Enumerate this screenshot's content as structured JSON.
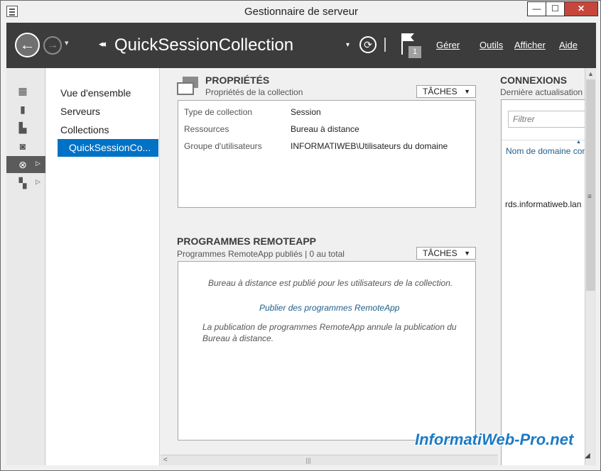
{
  "window": {
    "title": "Gestionnaire de serveur",
    "controls": {
      "minimize": "—",
      "maximize": "☐",
      "close": "✕"
    }
  },
  "navbar": {
    "back_icon": "←",
    "forward_icon": "→",
    "history_icon": "▾",
    "breadcrumb_arrows": "◂◂",
    "breadcrumb_title": "QuickSessionCollection",
    "dropdown_icon": "▾",
    "refresh_icon": "⟳",
    "notification_count": "1",
    "menu": [
      "Gérer",
      "Outils",
      "Afficher",
      "Aide"
    ]
  },
  "rail": {
    "icons": [
      "dashboard-icon",
      "local-server-icon",
      "all-servers-icon",
      "file-storage-icon",
      "remote-desktop-icon",
      "storage-services-icon"
    ],
    "arrow": "▷"
  },
  "nav": {
    "items": [
      "Vue d'ensemble",
      "Serveurs",
      "Collections"
    ],
    "selected": "QuickSessionCo..."
  },
  "properties": {
    "title": "PROPRIÉTÉS",
    "subtitle": "Propriétés de la collection",
    "tasks_label": "TÂCHES",
    "caret": "▼",
    "rows": [
      {
        "label": "Type de collection",
        "value": "Session"
      },
      {
        "label": "Ressources",
        "value": "Bureau à distance"
      },
      {
        "label": "Groupe d'utilisateurs",
        "value": "INFORMATIWEB\\Utilisateurs du domaine"
      }
    ]
  },
  "remoteapp": {
    "title": "PROGRAMMES REMOTEAPP",
    "subtitle": "Programmes RemoteApp publiés | 0 au total",
    "tasks_label": "TÂCHES",
    "caret": "▼",
    "message": "Bureau à distance est publié pour les utilisateurs de la collection.",
    "link": "Publier des programmes RemoteApp",
    "note_line1": "La publication de programmes RemoteApp annule la publication du",
    "note_line2": "Bureau à distance."
  },
  "connections": {
    "title": "CONNEXIONS",
    "subtitle": "Dernière actualisation",
    "filter_placeholder": "Filtrer",
    "column_header": "Nom de domaine complet",
    "sort_caret": "▲",
    "rows": [
      "rds.informatiweb.lan"
    ]
  },
  "scroll": {
    "left": "<",
    "up": "▲",
    "grip": "≡",
    "hgrip": "|||"
  },
  "watermark": "InformatiWeb-Pro.net",
  "colors": {
    "navbar": "#3c3c3c",
    "selection": "#0072c6",
    "link": "#1e5e8a",
    "close": "#c7463c"
  }
}
